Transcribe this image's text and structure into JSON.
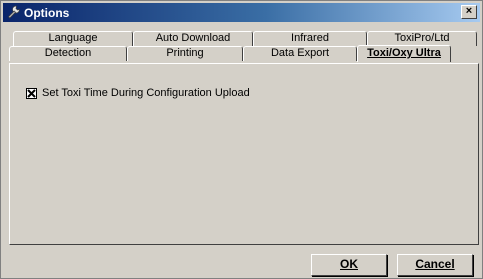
{
  "window": {
    "title": "Options",
    "close_label": "×"
  },
  "tabs": {
    "row_back": [
      "Language",
      "Auto Download",
      "Infrared",
      "ToxiPro/Ltd"
    ],
    "row_front": [
      "Detection",
      "Printing",
      "Data Export",
      "Toxi/Oxy Ultra"
    ],
    "active": "Toxi/Oxy Ultra"
  },
  "panel": {
    "checkbox": {
      "label": "Set Toxi Time During Configuration Upload",
      "checked": true
    }
  },
  "buttons": {
    "ok_label": "OK",
    "cancel_label": "Cancel"
  },
  "icons": {
    "title": "wrench-icon",
    "close": "close-icon",
    "check": "checkmark-icon"
  }
}
